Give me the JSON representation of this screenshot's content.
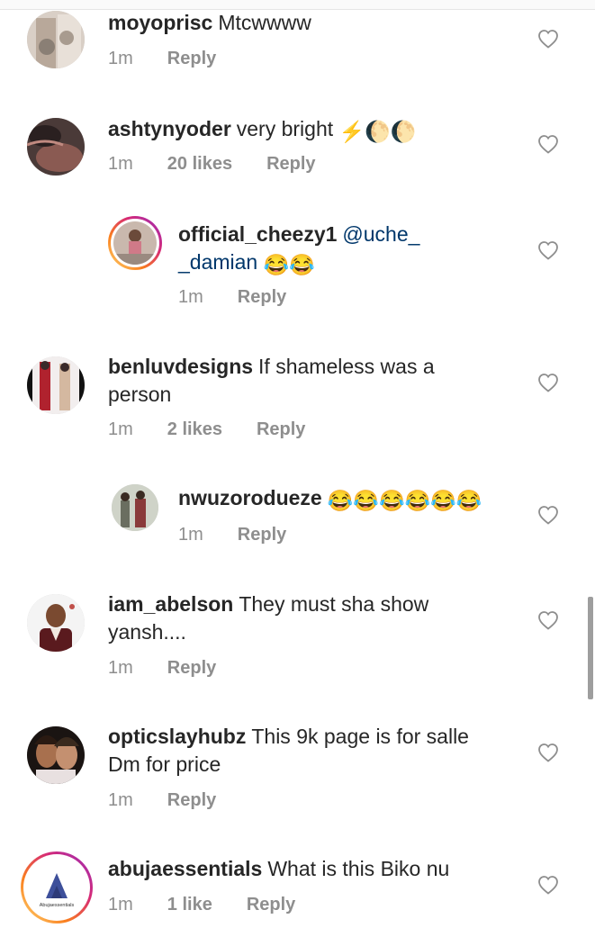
{
  "comments": [
    {
      "username": "moyoprisc",
      "text": "Mtcwwww",
      "time": "1m",
      "likes": "",
      "reply": "Reply",
      "emoji": ""
    },
    {
      "username": "ashtynyoder",
      "text": "very bright",
      "time": "1m",
      "likes": "20 likes",
      "reply": "Reply",
      "emoji": "⚡🌔🌔"
    },
    {
      "username": "official_cheezy1",
      "text": "@uche_",
      "text2": "_damian",
      "time": "1m",
      "likes": "",
      "reply": "Reply",
      "emoji": "😂😂"
    },
    {
      "username": "benluvdesigns",
      "text": "If shameless was a",
      "text2": "person",
      "time": "1m",
      "likes": "2 likes",
      "reply": "Reply",
      "emoji": ""
    },
    {
      "username": "nwuzorodueze",
      "text": "",
      "time": "1m",
      "likes": "",
      "reply": "Reply",
      "emoji": "😂😂😂😂😂😂"
    },
    {
      "username": "iam_abelson",
      "text": "They must sha show",
      "text2": "yansh....",
      "time": "1m",
      "likes": "",
      "reply": "Reply",
      "emoji": ""
    },
    {
      "username": "opticslayhubz",
      "text": "This 9k page is for salle",
      "text2": "Dm for price",
      "time": "1m",
      "likes": "",
      "reply": "Reply",
      "emoji": ""
    },
    {
      "username": "abujaessentials",
      "text": "What is this Biko nu",
      "time": "1m",
      "likes": "1 like",
      "reply": "Reply",
      "emoji": "",
      "logo_text": "Abujaessentials"
    }
  ]
}
